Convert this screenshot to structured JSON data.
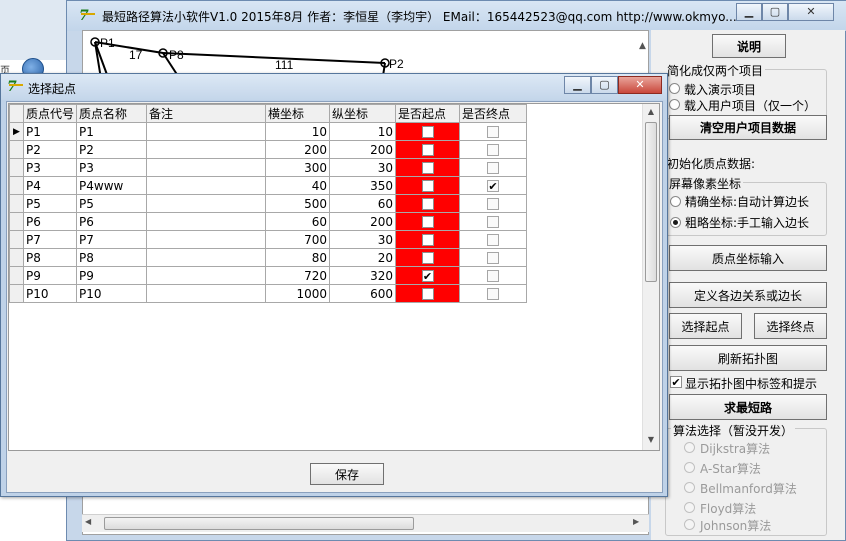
{
  "main_window": {
    "title": "最短路径算法小软件V1.0  2015年8月 作者：李恒星（李均宇） EMail：165442523@qq.com   http://www.okmyo..."
  },
  "canvas": {
    "nodes": [
      {
        "id": "n1",
        "label": "P1"
      },
      {
        "id": "n8",
        "label": "P8"
      },
      {
        "id": "n2",
        "label": "P2"
      }
    ],
    "edge_labels": [
      "17",
      "111"
    ]
  },
  "right_panel": {
    "help_button": "说明",
    "simplify_group": "简化成仅两个项目",
    "load_demo": "载入演示项目",
    "load_user": "载入用户项目（仅一个）",
    "clear_button": "清空用户项目数据",
    "init_label": "初始化质点数据:",
    "coord_group": "屏幕像素坐标",
    "precise": "精确坐标:自动计算边长",
    "rough": "粗略坐标:手工输入边长",
    "coord_input_button": "质点坐标输入",
    "define_edges_button": "定义各边关系或边长",
    "select_start_button": "选择起点",
    "select_end_button": "选择终点",
    "refresh_button": "刷新拓扑图",
    "show_labels_checkbox": "显示拓扑图中标签和提示",
    "solve_button": "求最短路",
    "algo_group": "算法选择（暂没开发）",
    "algorithms": [
      "Dijkstra算法",
      "A-Star算法",
      "Bellmanford算法",
      "Floyd算法",
      "Johnson算法"
    ]
  },
  "dialog": {
    "title": "选择起点",
    "columns": [
      "质点代号",
      "质点名称",
      "备注",
      "横坐标",
      "纵坐标",
      "是否起点",
      "是否终点"
    ],
    "rows": [
      {
        "code": "P1",
        "name": "P1",
        "note": "",
        "x": "10",
        "y": "10",
        "start": false,
        "end": false
      },
      {
        "code": "P2",
        "name": "P2",
        "note": "",
        "x": "200",
        "y": "200",
        "start": false,
        "end": false
      },
      {
        "code": "P3",
        "name": "P3",
        "note": "",
        "x": "300",
        "y": "30",
        "start": false,
        "end": false
      },
      {
        "code": "P4",
        "name": "P4www",
        "note": "",
        "x": "40",
        "y": "350",
        "start": false,
        "end": true
      },
      {
        "code": "P5",
        "name": "P5",
        "note": "",
        "x": "500",
        "y": "60",
        "start": false,
        "end": false
      },
      {
        "code": "P6",
        "name": "P6",
        "note": "",
        "x": "60",
        "y": "200",
        "start": false,
        "end": false
      },
      {
        "code": "P7",
        "name": "P7",
        "note": "",
        "x": "700",
        "y": "30",
        "start": false,
        "end": false
      },
      {
        "code": "P8",
        "name": "P8",
        "note": "",
        "x": "80",
        "y": "20",
        "start": false,
        "end": false
      },
      {
        "code": "P9",
        "name": "P9",
        "note": "",
        "x": "720",
        "y": "320",
        "start": true,
        "end": false
      },
      {
        "code": "P10",
        "name": "P10",
        "note": "",
        "x": "1000",
        "y": "600",
        "start": false,
        "end": false
      }
    ],
    "save_button": "保存"
  },
  "window_buttons": {
    "minimize": "▁",
    "maximize": "▢",
    "close": "✕"
  },
  "colors": {
    "start_column": "#ff0000",
    "close_button": "#c9473b"
  }
}
